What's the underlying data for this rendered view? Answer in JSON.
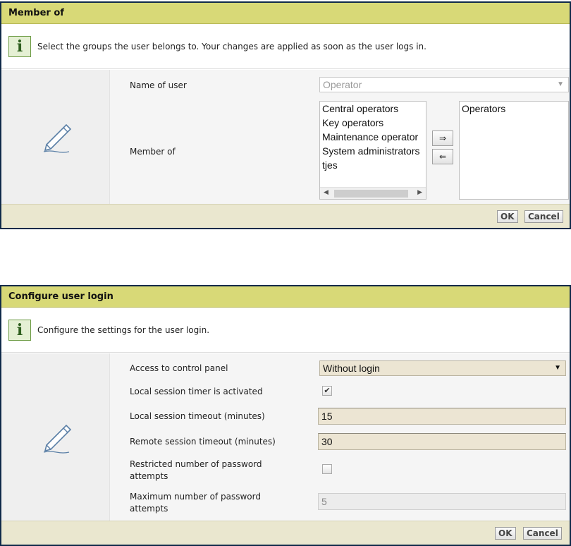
{
  "member_dialog": {
    "title": "Member of",
    "info": "Select the groups the user belongs to. Your changes are applied as soon as the user logs in.",
    "info_icon": "i",
    "name_label": "Name of user",
    "name_value": "Operator",
    "member_label": "Member of",
    "available_groups": [
      "Central operators",
      "Key operators",
      "Maintenance operator",
      "System administrators",
      "tjes"
    ],
    "selected_groups": [
      "Operators"
    ],
    "add_button": "⇒",
    "remove_button": "⇐",
    "ok": "OK",
    "cancel": "Cancel"
  },
  "login_dialog": {
    "title": "Configure user login",
    "info": "Configure the settings for the user login.",
    "info_icon": "i",
    "access_label": "Access to control panel",
    "access_value": "Without login",
    "timer_label": "Local session timer is activated",
    "timer_checked": true,
    "local_timeout_label": "Local session timeout (minutes)",
    "local_timeout_value": "15",
    "remote_timeout_label": "Remote session timeout (minutes)",
    "remote_timeout_value": "30",
    "restricted_label": "Restricted number of password attempts",
    "restricted_checked": false,
    "max_attempts_label": "Maximum number of password attempts",
    "max_attempts_value": "5",
    "ok": "OK",
    "cancel": "Cancel"
  },
  "icons": {
    "info": "info-icon",
    "edit": "pencil-icon",
    "dropdown": "chevron-down-icon",
    "check": "✔"
  },
  "colors": {
    "title_bar": "#d8d977",
    "border": "#102a4a",
    "footer": "#eae7cf",
    "input_bg": "#ece5d3"
  }
}
